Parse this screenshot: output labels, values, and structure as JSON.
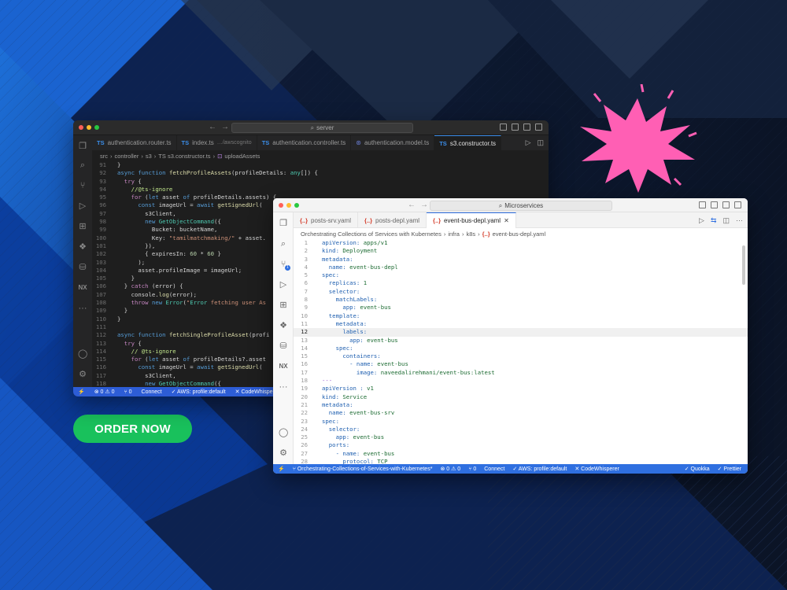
{
  "colors": {
    "accent": "#19c15c",
    "splash": "#ff5fb4",
    "status_bar": "#2f6fe0"
  },
  "order_button": {
    "label": "ORDER NOW"
  },
  "dark_window": {
    "search_text": "server",
    "tabs": [
      {
        "icon": "TS",
        "label": "authentication.router.ts"
      },
      {
        "icon": "TS",
        "label": "index.ts",
        "hint": "…/awscognito"
      },
      {
        "icon": "TS",
        "label": "authentication.controller.ts"
      },
      {
        "icon": "model-icon",
        "label": "authentication.model.ts"
      },
      {
        "icon": "TS",
        "label": "s3.constructor.ts"
      }
    ],
    "breadcrumb": [
      "src",
      "controller",
      "s3",
      "TS s3.constructor.ts",
      "uploadAssets"
    ],
    "code_lines": [
      {
        "n": "91",
        "t": "}"
      },
      {
        "n": "92",
        "t": "async function fetchProfileAssets(profileDetails: any[]) {"
      },
      {
        "n": "93",
        "t": "  try {"
      },
      {
        "n": "94",
        "t": "    //@ts-ignore"
      },
      {
        "n": "95",
        "t": "    for (let asset of profileDetails.assets) {"
      },
      {
        "n": "96",
        "t": "      const imageUrl = await getSignedUrl("
      },
      {
        "n": "97",
        "t": "        s3Client,"
      },
      {
        "n": "98",
        "t": "        new GetObjectCommand({"
      },
      {
        "n": "99",
        "t": "          Bucket: bucketName,"
      },
      {
        "n": "100",
        "t": "          Key: \"tamilmatchmaking/\" + asset."
      },
      {
        "n": "101",
        "t": "        }),"
      },
      {
        "n": "102",
        "t": "        { expiresIn: 60 * 60 }"
      },
      {
        "n": "103",
        "t": "      );"
      },
      {
        "n": "104",
        "t": "      asset.profileImage = imageUrl;"
      },
      {
        "n": "105",
        "t": "    }"
      },
      {
        "n": "106",
        "t": "  } catch (error) {"
      },
      {
        "n": "107",
        "t": "    console.log(error);"
      },
      {
        "n": "108",
        "t": "    throw new Error(\"Error fetching user As"
      },
      {
        "n": "109",
        "t": "  }"
      },
      {
        "n": "110",
        "t": "}"
      },
      {
        "n": "111",
        "t": ""
      },
      {
        "n": "112",
        "t": "async function fetchSingleProfileAsset(profi"
      },
      {
        "n": "113",
        "t": "  try {"
      },
      {
        "n": "114",
        "t": "    // @ts-ignore"
      },
      {
        "n": "115",
        "t": "    for (let asset of profileDetails?.asset"
      },
      {
        "n": "116",
        "t": "      const imageUrl = await getSignedUrl("
      },
      {
        "n": "117",
        "t": "        s3Client,"
      },
      {
        "n": "118",
        "t": "        new GetObjectCommand({"
      }
    ],
    "status_items": [
      "⊗ 0 ⚠ 0",
      "⑂ 0",
      "Connect",
      "✓ AWS: profile:default",
      "✕ CodeWhisperer"
    ]
  },
  "light_window": {
    "search_text": "Microservices",
    "tabs": [
      {
        "icon": "{..}",
        "label": "posts-srv.yaml"
      },
      {
        "icon": "{..}",
        "label": "posts-depl.yaml"
      },
      {
        "icon": "{..}",
        "label": "event-bus-depl.yaml"
      }
    ],
    "breadcrumb": [
      "Orchestrating Collections of Services with Kubernetes",
      "infra",
      "k8s",
      "event-bus-depl.yaml"
    ],
    "code_lines": [
      {
        "n": "1",
        "k": "apiVersion:",
        "v": " apps/v1"
      },
      {
        "n": "2",
        "k": "kind:",
        "v": " Deployment"
      },
      {
        "n": "3",
        "k": "metadata:",
        "v": ""
      },
      {
        "n": "4",
        "k": "  name:",
        "v": " event-bus-depl"
      },
      {
        "n": "5",
        "k": "spec:",
        "v": ""
      },
      {
        "n": "6",
        "k": "  replicas:",
        "v": " 1"
      },
      {
        "n": "7",
        "k": "  selector:",
        "v": ""
      },
      {
        "n": "8",
        "k": "    matchLabels:",
        "v": ""
      },
      {
        "n": "9",
        "k": "      app:",
        "v": " event-bus"
      },
      {
        "n": "10",
        "k": "  template:",
        "v": ""
      },
      {
        "n": "11",
        "k": "    metadata:",
        "v": ""
      },
      {
        "n": "12",
        "k": "      labels:",
        "v": ""
      },
      {
        "n": "13",
        "k": "        app:",
        "v": " event-bus"
      },
      {
        "n": "14",
        "k": "    spec:",
        "v": ""
      },
      {
        "n": "15",
        "k": "      containers:",
        "v": ""
      },
      {
        "n": "16",
        "k": "        - name:",
        "v": " event-bus"
      },
      {
        "n": "17",
        "k": "          image:",
        "v": " naveedalirehmani/event-bus:latest"
      },
      {
        "n": "18",
        "k": "---",
        "v": ""
      },
      {
        "n": "19",
        "k": "apiVersion :",
        "v": " v1"
      },
      {
        "n": "20",
        "k": "kind:",
        "v": " Service"
      },
      {
        "n": "21",
        "k": "metadata:",
        "v": ""
      },
      {
        "n": "22",
        "k": "  name:",
        "v": " event-bus-srv"
      },
      {
        "n": "23",
        "k": "spec:",
        "v": ""
      },
      {
        "n": "24",
        "k": "  selector:",
        "v": ""
      },
      {
        "n": "25",
        "k": "    app:",
        "v": " event-bus"
      },
      {
        "n": "26",
        "k": "  ports:",
        "v": ""
      },
      {
        "n": "27",
        "k": "    - name:",
        "v": " event-bus"
      },
      {
        "n": "28",
        "k": "      protocol:",
        "v": " TCP"
      }
    ],
    "highlighted_line": "12",
    "status_left": [
      "⑂ Orchestrating-Collections-of-Services-with-Kubernetes*",
      "⊗ 0 ⚠ 0",
      "⑂ 0",
      "Connect",
      "✓ AWS: profile:default",
      "✕ CodeWhisperer"
    ],
    "status_right": [
      "✓ Quokka",
      "✓ Prettier"
    ]
  }
}
